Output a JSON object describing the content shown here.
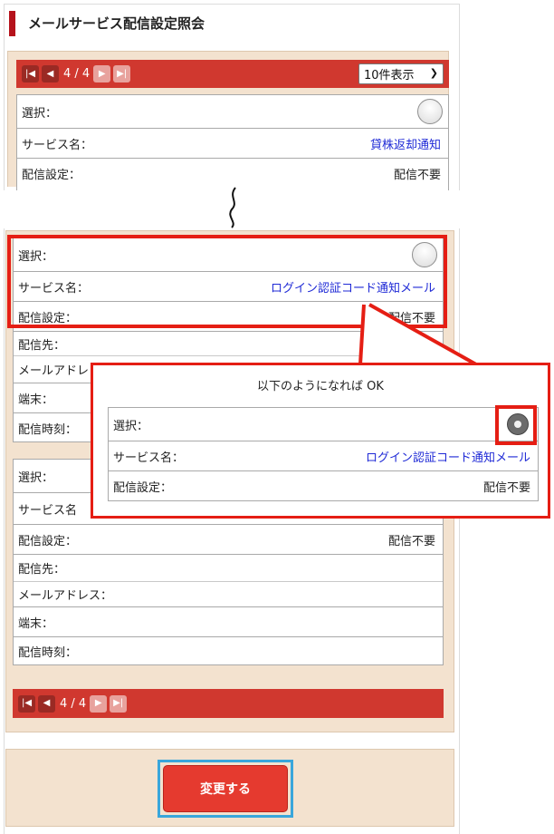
{
  "header": {
    "title": "メールサービス配信設定照会"
  },
  "pager": {
    "first_icon": "first-page-icon",
    "prev_icon": "prev-page-icon",
    "next_icon": "next-page-icon",
    "last_icon": "last-page-icon",
    "first_glyph": "|◀",
    "prev_glyph": "◀",
    "next_glyph": "▶",
    "last_glyph": "▶|",
    "status": "4 / 4",
    "per_page_selected": "10件表示"
  },
  "labels": {
    "select": "選択：",
    "service_name": "サービス名：",
    "delivery_setting": "配信設定：",
    "delivery_to": "配信先：",
    "email": "メールアドレス：",
    "terminal": "端末：",
    "delivery_time": "配信時刻："
  },
  "top_card": {
    "service_name": "貸株返却通知",
    "delivery_setting": "配信不要"
  },
  "card1": {
    "service_name": "ログイン認証コード通知メール",
    "delivery_setting": "配信不要",
    "email_label_partial": "メールアドレ",
    "delivery_time_label_partial": "配信時刻："
  },
  "card2": {
    "service_name_label_partial": "サービス名",
    "delivery_setting": "配信不要"
  },
  "callout": {
    "title": "以下のようになれば OK",
    "service_name": "ログイン認証コード通知メール",
    "delivery_setting": "配信不要"
  },
  "submit": {
    "label": "変更する"
  },
  "colors": {
    "accent_red": "#d0382f",
    "highlight_red": "#e51e14",
    "beige": "#f3e2cf",
    "link_blue": "#1f2ad6",
    "button_frame_blue": "#39a6db"
  }
}
